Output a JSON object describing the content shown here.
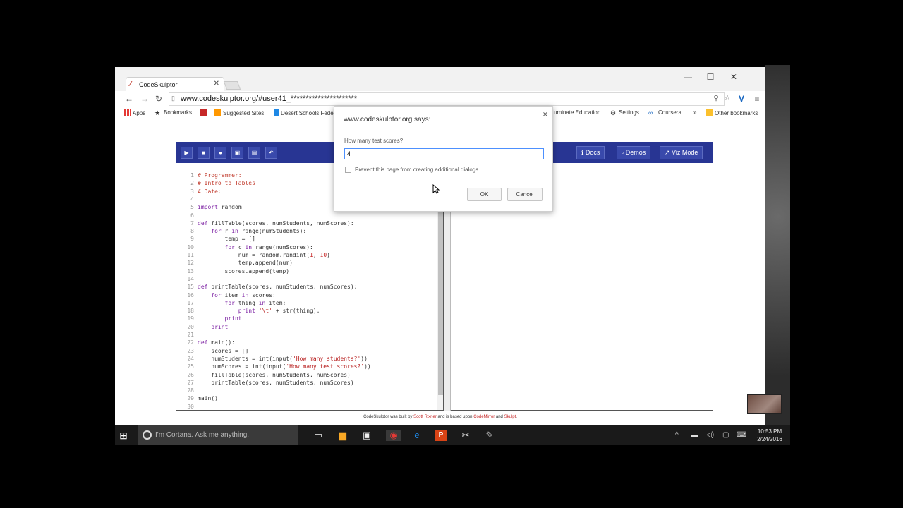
{
  "browser": {
    "tab_title": "CodeSkulptor",
    "url": "www.codeskulptor.org/#user41_**********************",
    "bookmarks": [
      "Apps",
      "Bookmarks",
      "Suggested Sites",
      "Desert Schools Fede",
      "uminate Education",
      "Settings",
      "Coursera",
      "Other bookmarks"
    ]
  },
  "toolbar": {
    "docs_label": "Docs",
    "demos_label": "Demos",
    "viz_label": "Viz Mode"
  },
  "code_lines": [
    "# Programmer:",
    "# Intro to Tables",
    "# Date:",
    "",
    "import random",
    "",
    "def fillTable(scores, numStudents, numScores):",
    "    for r in range(numStudents):",
    "        temp = []",
    "        for c in range(numScores):",
    "            num = random.randint(1, 10)",
    "            temp.append(num)",
    "        scores.append(temp)",
    "",
    "def printTable(scores, numStudents, numScores):",
    "    for item in scores:",
    "        for thing in item:",
    "            print '\\t' + str(thing),",
    "        print",
    "    print",
    "",
    "def main():",
    "    scores = []",
    "    numStudents = int(input('How many students?'))",
    "    numScores = int(input('How many test scores?'))",
    "    fillTable(scores, numStudents, numScores)",
    "    printTable(scores, numStudents, numScores)",
    "",
    "main()",
    ""
  ],
  "footer": {
    "prefix": "CodeSkulptor was built by ",
    "author": "Scott Rixner",
    "middle": " and is based upon ",
    "lib1": "CodeMirror",
    "and": " and ",
    "lib2": "Skulpt",
    "end": "."
  },
  "dialog": {
    "title": "www.codeskulptor.org says:",
    "prompt": "How many test scores?",
    "input_value": "4",
    "checkbox_label": "Prevent this page from creating additional dialogs.",
    "ok_label": "OK",
    "cancel_label": "Cancel"
  },
  "taskbar": {
    "cortana_placeholder": "I'm Cortana. Ask me anything.",
    "time": "10:53 PM",
    "date": "2/24/2016"
  }
}
